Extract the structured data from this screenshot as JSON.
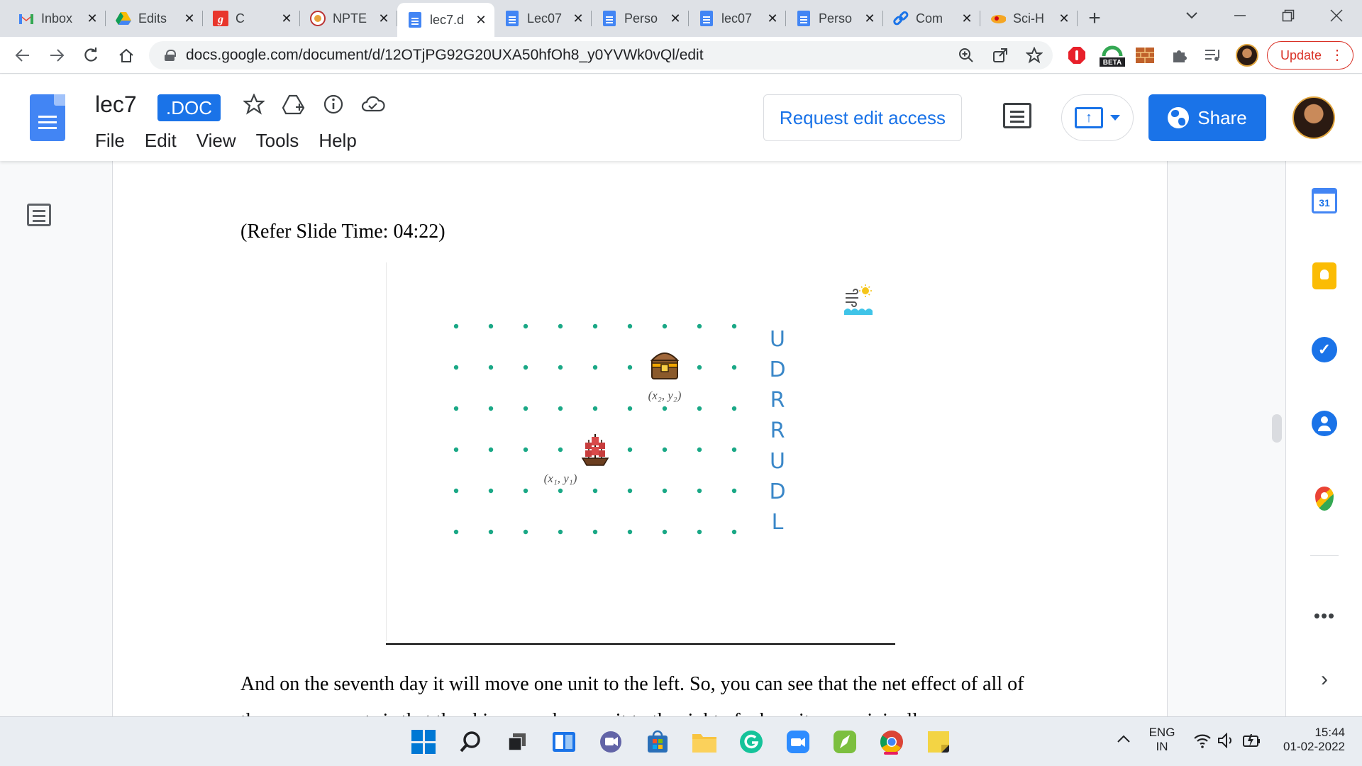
{
  "browser": {
    "tabs": [
      {
        "title": "Inbox",
        "icon": "gmail-icon"
      },
      {
        "title": "Edits",
        "icon": "drive-icon"
      },
      {
        "title": "C",
        "icon": "g-icon"
      },
      {
        "title": "NPTE",
        "icon": "nptel-icon"
      },
      {
        "title": "lec7.d",
        "icon": "docs-icon"
      },
      {
        "title": "Lec07",
        "icon": "docs-icon"
      },
      {
        "title": "Perso",
        "icon": "docs-icon"
      },
      {
        "title": "lec07",
        "icon": "docs-icon"
      },
      {
        "title": "Perso",
        "icon": "docs-icon"
      },
      {
        "title": "Com",
        "icon": "link-icon"
      },
      {
        "title": "Sci-H",
        "icon": "scihub-icon"
      }
    ],
    "active_tab": 4,
    "url": "docs.google.com/document/d/12OTjPG92G20UXA50hfOh8_y0YVWk0vQl/edit",
    "update_label": "Update",
    "beta_label": "BETA"
  },
  "docs": {
    "title": "lec7",
    "badge": ".DOC",
    "menu": [
      "File",
      "Edit",
      "View",
      "Tools",
      "Help"
    ],
    "request_edit_label": "Request edit access",
    "share_label": "Share"
  },
  "document": {
    "ref_time": "(Refer Slide Time: 04:22)",
    "paragraph": "And on the seventh day it will move one unit to the left. So, you can see that the net effect of all of these movements is that the ship moved one unit to the right of where it was originally."
  },
  "figure": {
    "grid_cols": 9,
    "grid_rows": 6,
    "dot_color": "#1aa886",
    "ship_col": 4,
    "ship_row": 4,
    "chest_col": 6,
    "chest_row": 2,
    "ship_label": "(x₁, y₁)",
    "chest_label": "(x₂, y₂)",
    "moves": [
      "U",
      "D",
      "R",
      "R",
      "U",
      "D",
      "L"
    ],
    "moves_color": "#3a87c8"
  },
  "sidepanel": {
    "calendar_day": "31"
  },
  "taskbar": {
    "lang": "ENG",
    "region": "IN",
    "time": "15:44",
    "date": "01-02-2022"
  }
}
